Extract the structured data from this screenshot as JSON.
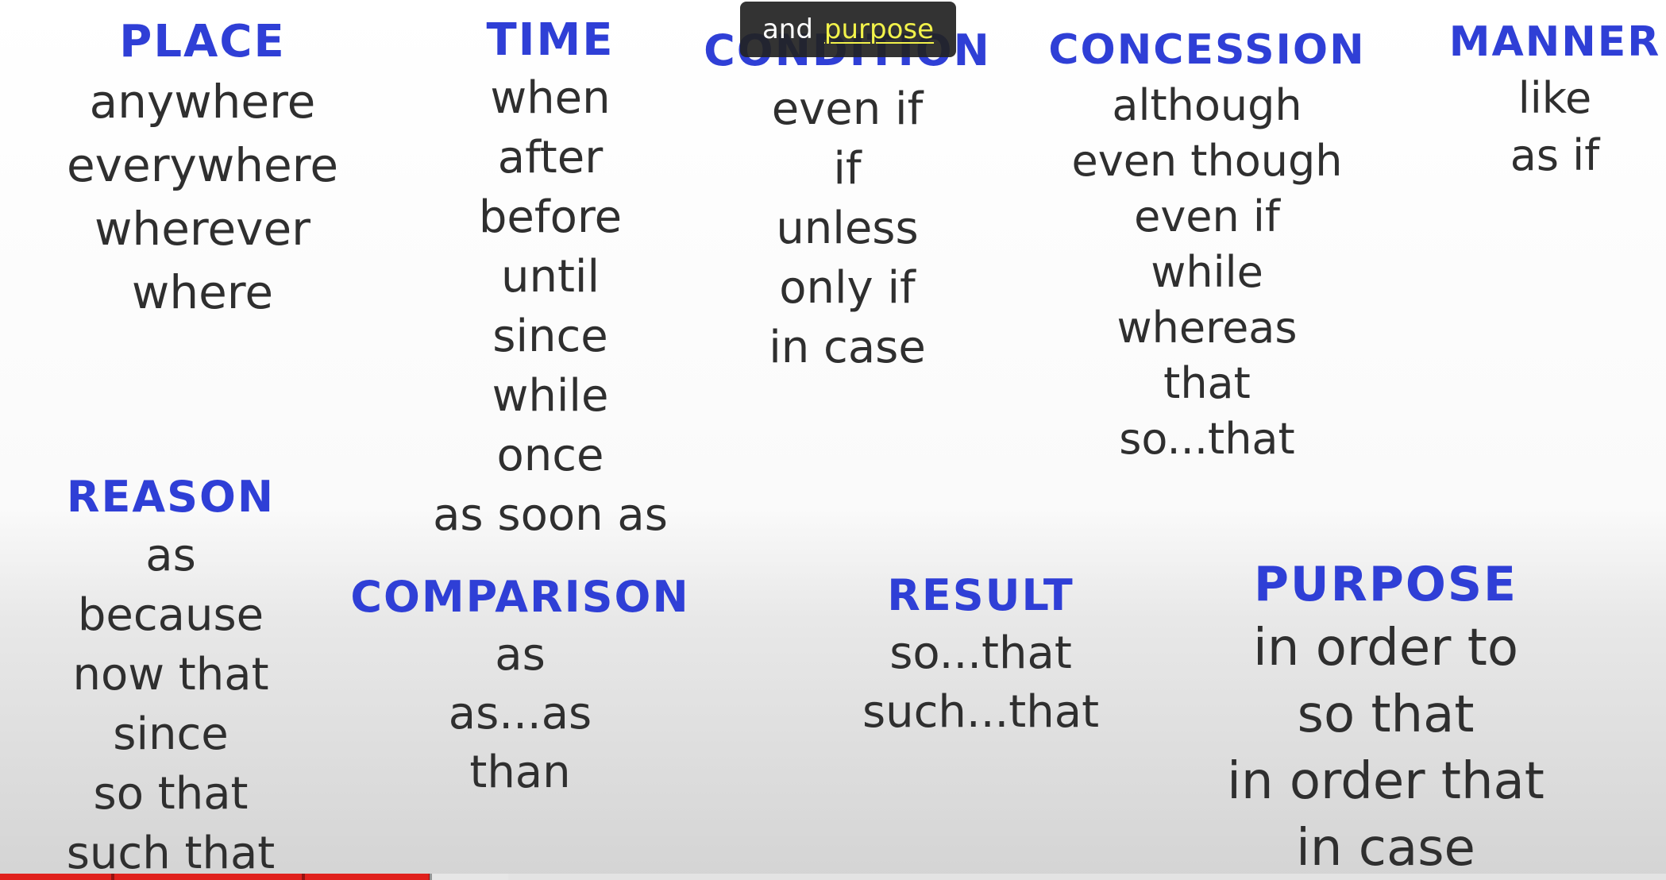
{
  "colors": {
    "heading": "#2f3fd6",
    "word": "#2f2f2f",
    "caption_bg": "#222222",
    "caption_highlight": "#f2f24a",
    "progress_played": "#e0201c"
  },
  "slide": {
    "groups": [
      {
        "id": "place",
        "heading": "PLACE",
        "items": [
          "anywhere",
          "everywhere",
          "wherever",
          "where"
        ]
      },
      {
        "id": "time",
        "heading": "TIME",
        "items": [
          "when",
          "after",
          "before",
          "until",
          "since",
          "while",
          "once",
          "as soon as"
        ]
      },
      {
        "id": "condition",
        "heading": "CONDITION",
        "items": [
          "even if",
          "if",
          "unless",
          "only if",
          "in case"
        ]
      },
      {
        "id": "concession",
        "heading": "CONCESSION",
        "items": [
          "although",
          "even though",
          "even if",
          "while",
          "whereas",
          "that",
          "so...that"
        ]
      },
      {
        "id": "manner",
        "heading": "MANNER",
        "items": [
          "like",
          "as if"
        ]
      },
      {
        "id": "reason",
        "heading": "REASON",
        "items": [
          "as",
          "because",
          "now that",
          "since",
          "so that",
          "such that"
        ]
      },
      {
        "id": "comparison",
        "heading": "COMPARISON",
        "items": [
          "as",
          "as...as",
          "than"
        ]
      },
      {
        "id": "result",
        "heading": "RESULT",
        "items": [
          "so...that",
          "such...that"
        ]
      },
      {
        "id": "purpose",
        "heading": "PURPOSE",
        "items": [
          "in order to",
          "so that",
          "in order that",
          "in case"
        ]
      }
    ]
  },
  "caption": {
    "word_1": "and",
    "word_2": "purpose"
  },
  "player": {
    "progress_fraction": 0.258,
    "buffered_fraction": 0.305
  }
}
